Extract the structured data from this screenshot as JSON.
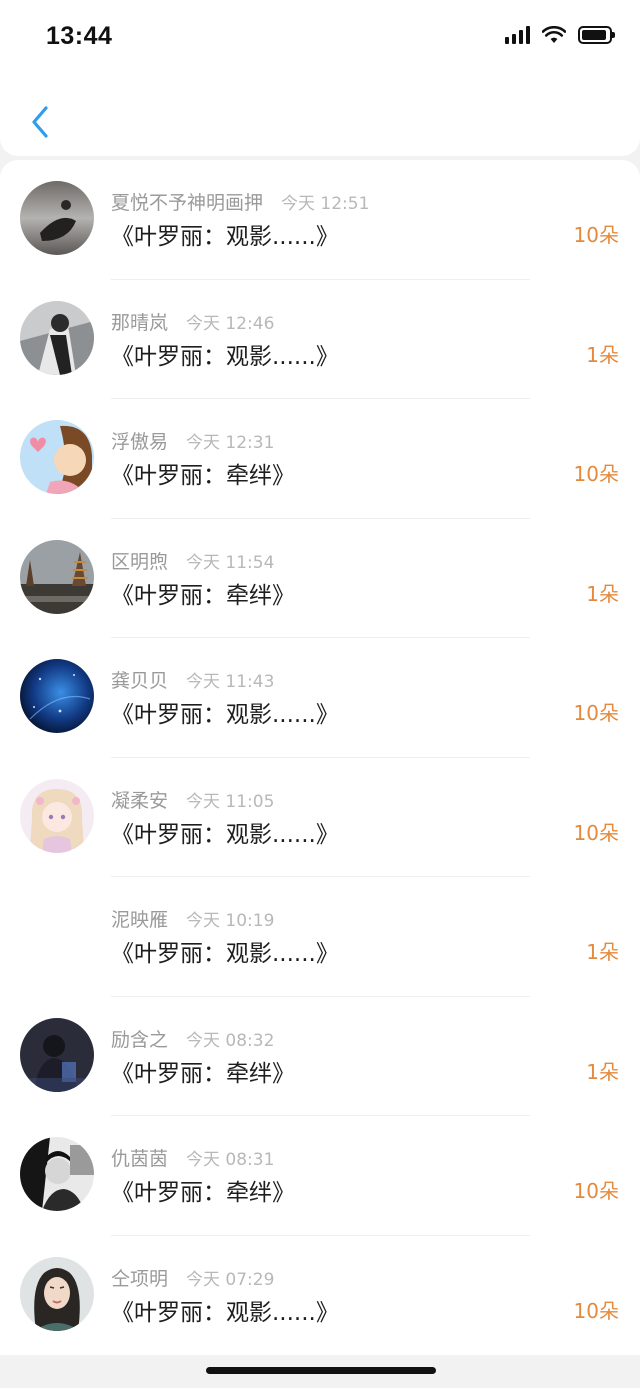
{
  "status_bar": {
    "time": "13:44"
  },
  "list": {
    "items": [
      {
        "name": "夏悦不予神明画押",
        "time": "今天 12:51",
        "gift": "《叶罗丽：观影......》",
        "count": "10朵",
        "avatar": "avatar-1"
      },
      {
        "name": "那晴岚",
        "time": "今天 12:46",
        "gift": "《叶罗丽：观影......》",
        "count": "1朵",
        "avatar": "avatar-2"
      },
      {
        "name": "浮傲易",
        "time": "今天 12:31",
        "gift": "《叶罗丽：牵绊》",
        "count": "10朵",
        "avatar": "avatar-3"
      },
      {
        "name": "区明煦",
        "time": "今天 11:54",
        "gift": "《叶罗丽：牵绊》",
        "count": "1朵",
        "avatar": "avatar-4"
      },
      {
        "name": "龚贝贝",
        "time": "今天 11:43",
        "gift": "《叶罗丽：观影......》",
        "count": "10朵",
        "avatar": "avatar-5"
      },
      {
        "name": "凝柔安",
        "time": "今天 11:05",
        "gift": "《叶罗丽：观影......》",
        "count": "10朵",
        "avatar": "avatar-6"
      },
      {
        "name": "泥映雁",
        "time": "今天 10:19",
        "gift": "《叶罗丽：观影......》",
        "count": "1朵",
        "avatar": "none"
      },
      {
        "name": "励含之",
        "time": "今天 08:32",
        "gift": "《叶罗丽：牵绊》",
        "count": "1朵",
        "avatar": "avatar-8"
      },
      {
        "name": "仇茵茵",
        "time": "今天 08:31",
        "gift": "《叶罗丽：牵绊》",
        "count": "10朵",
        "avatar": "avatar-9"
      },
      {
        "name": "仝项明",
        "time": "今天 07:29",
        "gift": "《叶罗丽：观影......》",
        "count": "10朵",
        "avatar": "avatar-10"
      }
    ]
  },
  "colors": {
    "accent_blue": "#2e9df0",
    "count_orange": "#e48a3e",
    "name_gray": "#9a9a9a",
    "time_gray": "#b8b8b8",
    "title_dark": "#1e1e1e"
  },
  "icons": {
    "back": "chevron-left-icon",
    "signal": "cellular-signal-icon",
    "wifi": "wifi-icon",
    "battery": "battery-icon"
  }
}
